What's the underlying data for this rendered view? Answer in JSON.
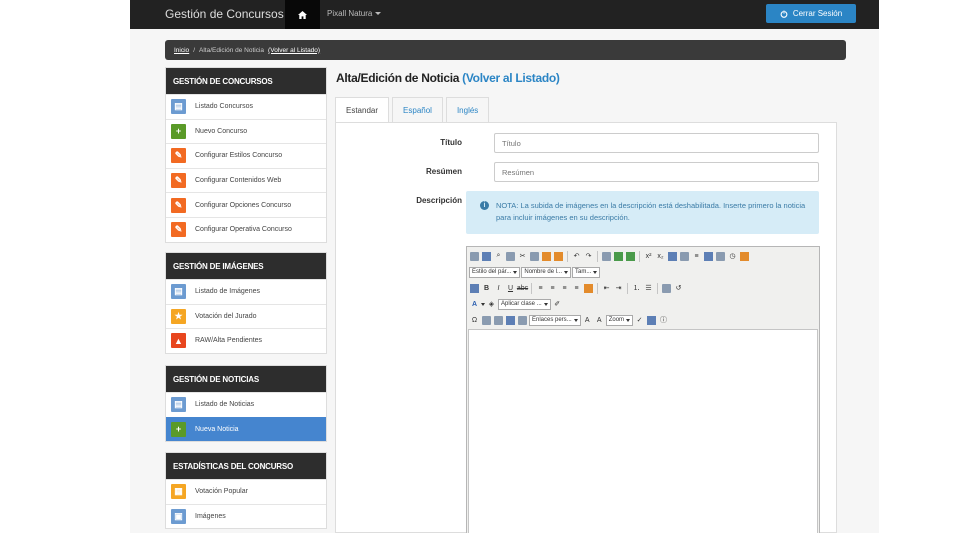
{
  "navbar": {
    "brand": "Gestión de Concursos",
    "menu_label": "Pixall Natura",
    "logout_label": "Cerrar Sesión"
  },
  "breadcrumb": {
    "home": "Inicio",
    "separator": "/",
    "current": "Alta/Edición de Noticia",
    "back_link": "(Volver al Listado)"
  },
  "sidebar": {
    "sections": [
      {
        "title": "GESTIÓN DE CONCURSOS",
        "items": [
          {
            "label": "Listado Concursos",
            "icon": "document-icon"
          },
          {
            "label": "Nuevo Concurso",
            "icon": "plus-icon"
          },
          {
            "label": "Configurar Estilos Concurso",
            "icon": "wrench-icon"
          },
          {
            "label": "Configurar Contenidos Web",
            "icon": "wrench-icon"
          },
          {
            "label": "Configurar Opciones Concurso",
            "icon": "wrench-icon"
          },
          {
            "label": "Configurar Operativa Concurso",
            "icon": "wrench-icon"
          }
        ]
      },
      {
        "title": "GESTIÓN DE IMÁGENES",
        "items": [
          {
            "label": "Listado de Imágenes",
            "icon": "document-icon"
          },
          {
            "label": "Votación del Jurado",
            "icon": "star-icon"
          },
          {
            "label": "RAW/Alta Pendientes",
            "icon": "warning-icon"
          }
        ]
      },
      {
        "title": "GESTIÓN DE NOTICIAS",
        "items": [
          {
            "label": "Listado de Noticias",
            "icon": "document-icon"
          },
          {
            "label": "Nueva Noticia",
            "icon": "plus-icon"
          }
        ]
      },
      {
        "title": "ESTADÍSTICAS DEL CONCURSO",
        "items": [
          {
            "label": "Votación Popular",
            "icon": "chart-icon"
          },
          {
            "label": "Imágenes",
            "icon": "image-icon"
          }
        ]
      }
    ]
  },
  "main": {
    "title": "Alta/Edición de Noticia",
    "title_link": "(Volver al Listado)",
    "tabs": [
      {
        "label": "Estandar",
        "active": true
      },
      {
        "label": "Español",
        "active": false
      },
      {
        "label": "Inglés",
        "active": false
      }
    ],
    "form": {
      "titulo_label": "Título",
      "titulo_placeholder": "Título",
      "resumen_label": "Resúmen",
      "resumen_placeholder": "Resúmen",
      "descripcion_label": "Descripción",
      "note": "NOTA: La subida de imágenes en la descripción está deshabilitada. Inserte primero la noticia para incluir imágenes en su descripción."
    },
    "editor": {
      "style_select": "Estilo del pár...",
      "font_select": "Nombre de l...",
      "size_select": "Tam...",
      "class_select": "Aplicar clase ...",
      "links_select": "Enlaces pers...",
      "zoom_select": "Zoom"
    }
  },
  "colors": {
    "navbar_bg": "#222222",
    "accent": "#2b85c5",
    "active_item": "#4585cf",
    "sidebar_header": "#2d2d2d",
    "note_bg": "#d6ecf7"
  }
}
